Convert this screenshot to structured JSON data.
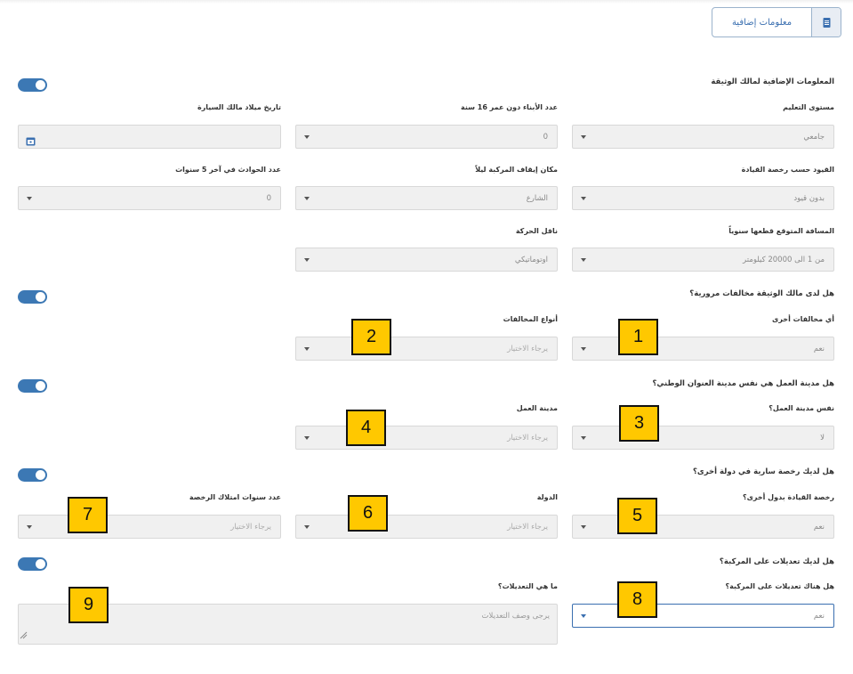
{
  "header": {
    "extra_info_button": "معلومات إضافية",
    "extra_info_icon": "document-icon"
  },
  "sections": {
    "owner_extra_info": "المعلومات الإضافية لمالك الوثيقة",
    "traffic_violations": "هل لدى مالك الوثيقة مخالفات مرورية؟",
    "work_city_same": "هل مدينة العمل هي نفس مدينة العنوان الوطني؟",
    "foreign_license": "هل لديك رخصة سارية في دولة أخرى؟",
    "vehicle_modifications": "هل لديك تعديلات على المركبة؟"
  },
  "fields": {
    "education_level": {
      "label": "مستوى التعليم",
      "value": "جامعي"
    },
    "children_under_16": {
      "label": "عدد الأبناء دون عمر 16 سنة",
      "value": "0"
    },
    "owner_birth_date": {
      "label": "تاريخ ميلاد مالك السيارة",
      "value": ""
    },
    "license_restrictions": {
      "label": "القيود حسب رخصة القيادة",
      "value": "بدون قيود"
    },
    "night_parking": {
      "label": "مكان إيقاف المركبة ليلاً",
      "value": "الشارع"
    },
    "accidents_5_years": {
      "label": "عدد الحوادث في آخر 5 سنوات",
      "value": "0"
    },
    "annual_distance": {
      "label": "المسافة المتوقع قطعها سنوياً",
      "value": "من 1 الى 20000 كيلومتر"
    },
    "transmission": {
      "label": "ناقل الحركة",
      "value": "اوتوماتيكي"
    },
    "other_violations": {
      "label": "أي مخالفات أخرى",
      "value": "نعم"
    },
    "violation_types": {
      "label": "أنواع المخالفات",
      "placeholder": "يرجاء الاختيار"
    },
    "same_work_city": {
      "label": "نفس مدينة العمل؟",
      "value": "لا"
    },
    "work_city": {
      "label": "مدينة العمل",
      "placeholder": "يرجاء الاختيار"
    },
    "gcc_license": {
      "label": "رخصة القيادة بدول أخرى؟",
      "value": "نعم"
    },
    "country": {
      "label": "الدولة",
      "placeholder": "يرجاء الاختيار"
    },
    "license_years": {
      "label": "عدد سنوات امتلاك الرخصة",
      "placeholder": "يرجاء الاختيار"
    },
    "has_modifications": {
      "label": "هل هناك تعديلات على المركبة؟",
      "value": "نعم"
    },
    "modifications_desc": {
      "label": "ما هي التعديلات؟",
      "placeholder": "يرجى وصف التعديلات"
    }
  },
  "toggles": {
    "owner_extra_info": true,
    "traffic_violations": true,
    "work_city_same": true,
    "foreign_license": true,
    "vehicle_modifications": true
  },
  "markers": [
    "1",
    "2",
    "3",
    "4",
    "5",
    "6",
    "7",
    "8",
    "9"
  ],
  "colors": {
    "accent": "#3c78b4",
    "marker_fill": "#ffc800",
    "field_bg": "#f0f0f0"
  }
}
